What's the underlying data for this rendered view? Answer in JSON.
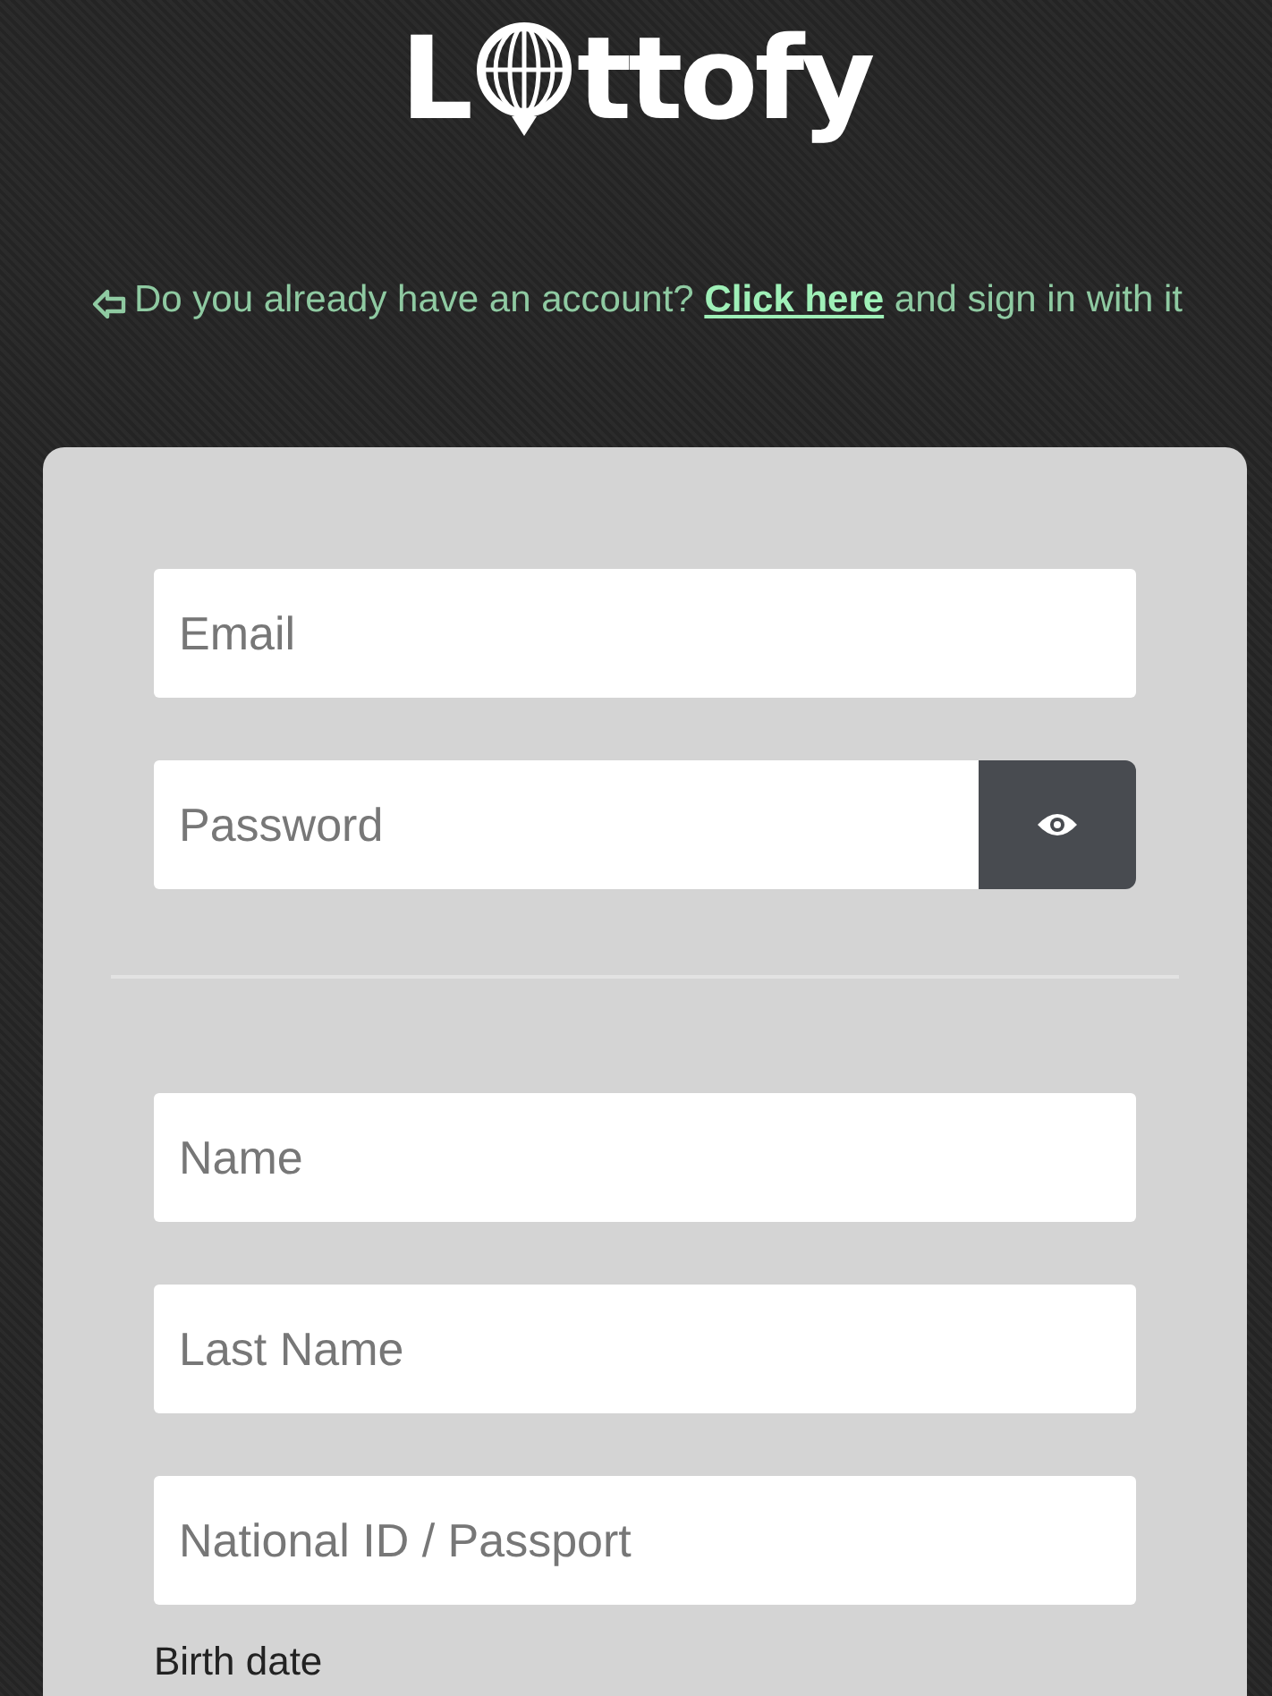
{
  "logo": {
    "before": "L",
    "after": "ttofy"
  },
  "signin_notice": {
    "text": "Do you already have an account? ",
    "link": "Click here",
    "after": " and sign in with it"
  },
  "account_fields": [
    {
      "placeholder": "Email",
      "kind": "text"
    },
    {
      "placeholder": "Password",
      "kind": "password"
    }
  ],
  "personal_fields": [
    {
      "placeholder": "Name"
    },
    {
      "placeholder": "Last Name"
    },
    {
      "placeholder": "National ID / Passport"
    }
  ],
  "birth_date_label": "Birth date"
}
